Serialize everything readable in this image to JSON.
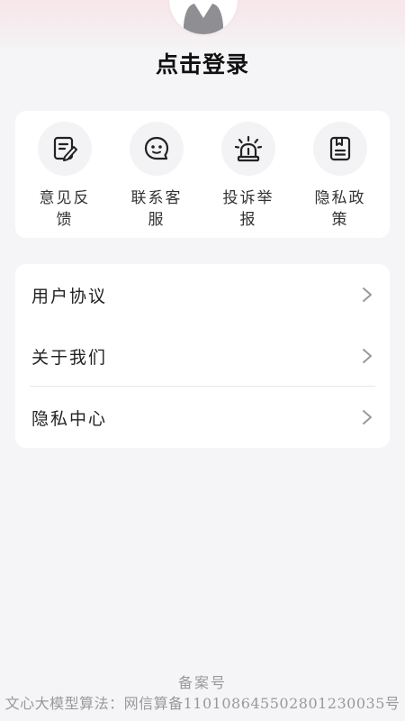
{
  "header": {
    "login_label": "点击登录"
  },
  "quick_actions": [
    {
      "label": "意见反馈",
      "icon": "feedback-icon"
    },
    {
      "label": "联系客服",
      "icon": "customer-service-icon"
    },
    {
      "label": "投诉举报",
      "icon": "alarm-icon"
    },
    {
      "label": "隐私政策",
      "icon": "document-icon"
    }
  ],
  "menu": [
    {
      "label": "用户协议",
      "icon": "chevron-right-icon"
    },
    {
      "label": "关于我们",
      "icon": "chevron-right-icon"
    },
    {
      "label": "隐私中心",
      "icon": "chevron-right-icon"
    }
  ],
  "footer": {
    "record_label": "备案号",
    "algorithm_record": "文心大模型算法：网信算备110108645502801230035号"
  },
  "colors": {
    "background": "#f5f5f7",
    "card": "#ffffff",
    "icon_circle": "#f3f3f5",
    "text_primary": "#222222",
    "text_muted": "#999999",
    "avatar_silhouette": "#8e8e93"
  }
}
